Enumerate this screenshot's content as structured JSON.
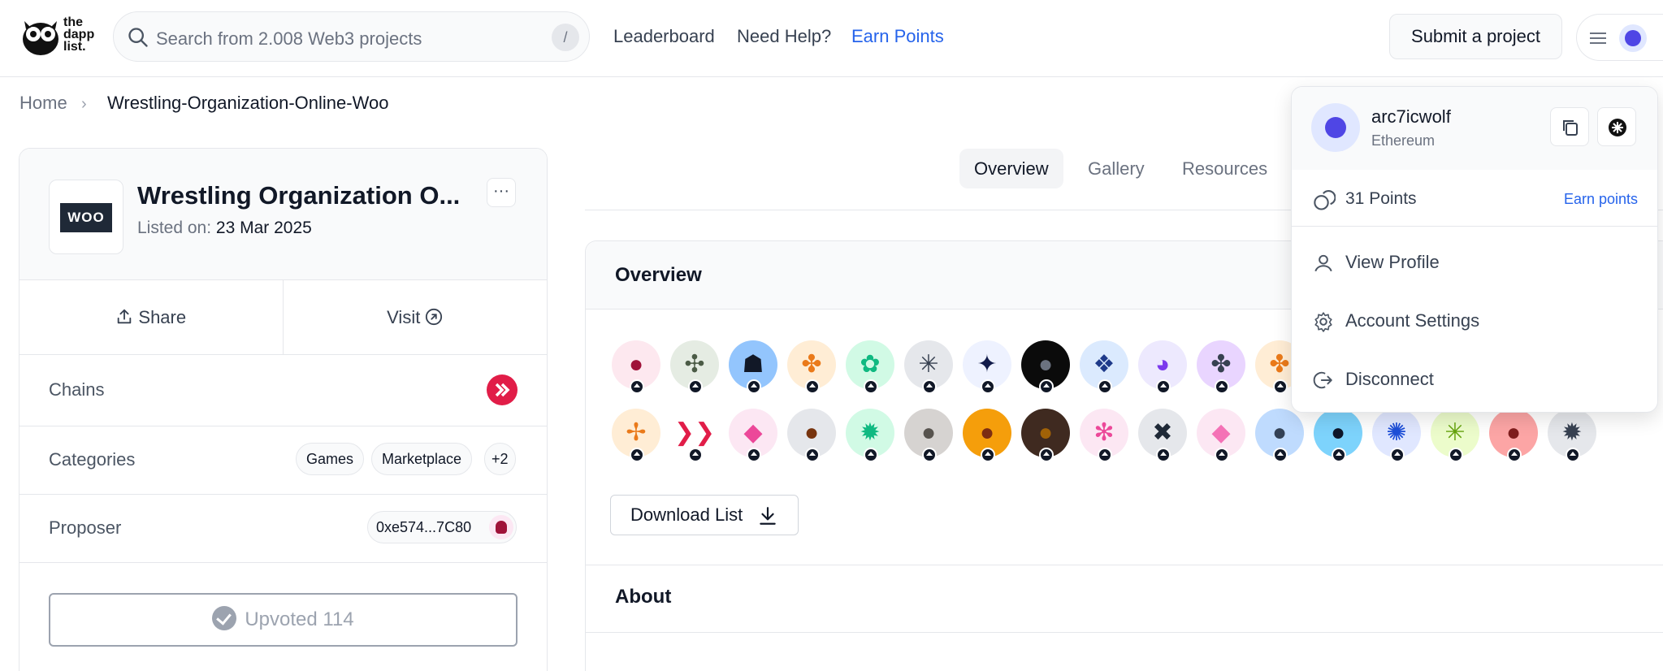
{
  "header": {
    "logo_text": [
      "the",
      "dapp",
      "list."
    ],
    "search_placeholder": "Search from 2.008 Web3 projects",
    "search_shortcut": "/",
    "nav": [
      "Leaderboard",
      "Need Help?",
      "Earn Points"
    ],
    "submit_label": "Submit a project"
  },
  "breadcrumb": {
    "home": "Home",
    "current": "Wrestling-Organization-Online-Woo"
  },
  "project": {
    "logo_text": "WOO",
    "title": "Wrestling Organization O...",
    "listed_label": "Listed on: ",
    "listed_date": "23 Mar 2025",
    "more_label": "···",
    "share_label": "Share",
    "visit_label": "Visit",
    "chains_label": "Chains",
    "categories_label": "Categories",
    "categories": [
      "Games",
      "Marketplace",
      "+2"
    ],
    "proposer_label": "Proposer",
    "proposer_address": "0xe574...7C80",
    "upvoted_label": "Upvoted 114"
  },
  "tabs": [
    "Overview",
    "Gallery",
    "Resources"
  ],
  "overview": {
    "title": "Overview",
    "download_label": "Download List",
    "about_title": "About",
    "avatars_row1": [
      {
        "bg": "#fde8ef",
        "fg": "#9f1239",
        "glyph": "●"
      },
      {
        "bg": "#e5ece3",
        "fg": "#4b5b46",
        "glyph": "✣"
      },
      {
        "bg": "#93c5fd",
        "fg": "#111827",
        "glyph": "☗"
      },
      {
        "bg": "#ffedd5",
        "fg": "#ea7a1a",
        "glyph": "✤"
      },
      {
        "bg": "#d1fae5",
        "fg": "#10b981",
        "glyph": "✿"
      },
      {
        "bg": "#e5e7eb",
        "fg": "#374151",
        "glyph": "✳"
      },
      {
        "bg": "#eef2ff",
        "fg": "#111b4a",
        "glyph": "✦"
      },
      {
        "bg": "#0b0b0b",
        "fg": "#6b7280",
        "glyph": "●"
      },
      {
        "bg": "#dbeafe",
        "fg": "#1e3a8a",
        "glyph": "❖"
      },
      {
        "bg": "#ede9fe",
        "fg": "#7c3aed",
        "glyph": "◕"
      },
      {
        "bg": "#e9d5ff",
        "fg": "#374151",
        "glyph": "✤"
      },
      {
        "bg": "#ffedd5",
        "fg": "#ea7a1a",
        "glyph": "✤"
      }
    ],
    "avatars_row2": [
      {
        "bg": "#ffedd5",
        "fg": "#ea7a1a",
        "glyph": "✢"
      },
      {
        "bg": "#ffffff",
        "fg": "#e11d48",
        "glyph": "❯❯"
      },
      {
        "bg": "#fce7f3",
        "fg": "#ec4899",
        "glyph": "◆"
      },
      {
        "bg": "#e5e7eb",
        "fg": "#78350f",
        "glyph": "●"
      },
      {
        "bg": "#d1fae5",
        "fg": "#10b981",
        "glyph": "✹"
      },
      {
        "bg": "#d6d3d1",
        "fg": "#57534e",
        "glyph": "●"
      },
      {
        "bg": "#f59e0b",
        "fg": "#7c2d12",
        "glyph": "●"
      },
      {
        "bg": "#3f2a20",
        "fg": "#a16207",
        "glyph": "●"
      },
      {
        "bg": "#fce7f3",
        "fg": "#ec4899",
        "glyph": "✻"
      },
      {
        "bg": "#e5e7eb",
        "fg": "#1f2937",
        "glyph": "✖"
      },
      {
        "bg": "#fce7f3",
        "fg": "#f472b6",
        "glyph": "◆"
      },
      {
        "bg": "#bfdbfe",
        "fg": "#334155",
        "glyph": "●"
      },
      {
        "bg": "#7dd3fc",
        "fg": "#0f172a",
        "glyph": "●"
      },
      {
        "bg": "#e0e7ff",
        "fg": "#1d4ed8",
        "glyph": "✺"
      },
      {
        "bg": "#ecfccb",
        "fg": "#65a30d",
        "glyph": "✳"
      },
      {
        "bg": "#fca5a5",
        "fg": "#7f1d1d",
        "glyph": "●"
      },
      {
        "bg": "#e5e7eb",
        "fg": "#374151",
        "glyph": "✹"
      }
    ]
  },
  "dropdown": {
    "username": "arc7icwolf",
    "chain": "Ethereum",
    "points": "31 Points",
    "earn_label": "Earn points",
    "items": [
      "View Profile",
      "Account Settings",
      "Disconnect"
    ]
  },
  "colors": {
    "accent": "#2563eb",
    "avatar": "#4f46e5",
    "hive": "#e11d48"
  }
}
